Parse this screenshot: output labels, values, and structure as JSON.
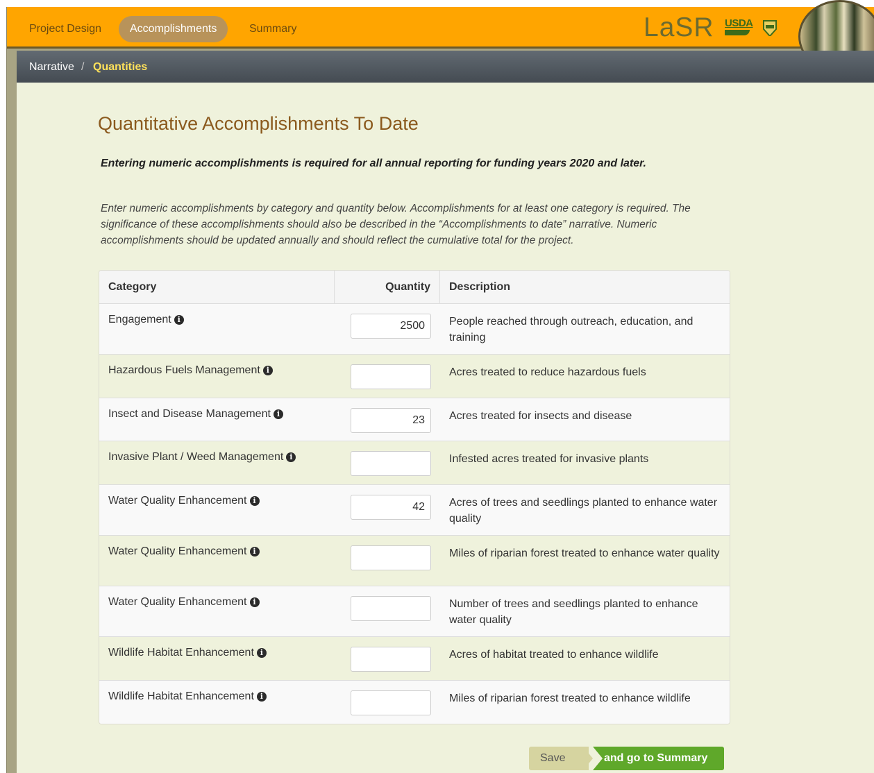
{
  "nav": {
    "tabs": [
      {
        "label": "Project Design",
        "active": false
      },
      {
        "label": "Accomplishments",
        "active": true
      },
      {
        "label": "Summary",
        "active": false
      }
    ]
  },
  "brand": {
    "app_name": "LaSR",
    "usda_label": "USDA",
    "accent_color": "#ffa500"
  },
  "breadcrumb": {
    "items": [
      "Narrative",
      "Quantities"
    ],
    "separator": "/"
  },
  "page": {
    "title": "Quantitative Accomplishments To Date",
    "notice": "Entering numeric accomplishments is required for all annual reporting for funding years 2020 and later.",
    "instructions": "Enter numeric accomplishments by category and quantity below. Accomplishments for at least one category is required. The significance of these accomplishments should also be described in the “Accomplishments to date” narrative. Numeric accomplishments should be updated annually and should reflect the cumulative total for the project."
  },
  "table": {
    "headers": {
      "category": "Category",
      "quantity": "Quantity",
      "description": "Description"
    },
    "info_icon": "info-circle-icon",
    "rows": [
      {
        "category": "Engagement",
        "quantity": "2500",
        "description": "People reached through outreach, education, and training"
      },
      {
        "category": "Hazardous Fuels Management",
        "quantity": "",
        "description": "Acres treated to reduce hazardous fuels"
      },
      {
        "category": "Insect and Disease Management",
        "quantity": "23",
        "description": "Acres treated for insects and disease"
      },
      {
        "category": "Invasive Plant / Weed Management",
        "quantity": "",
        "description": "Infested acres treated for invasive plants"
      },
      {
        "category": "Water Quality Enhancement",
        "quantity": "42",
        "description": "Acres of trees and seedlings planted to enhance water quality"
      },
      {
        "category": "Water Quality Enhancement",
        "quantity": "",
        "description": "Miles of riparian forest treated to enhance water quality"
      },
      {
        "category": "Water Quality Enhancement",
        "quantity": "",
        "description": "Number of trees and seedlings planted to enhance water quality"
      },
      {
        "category": "Wildlife Habitat Enhancement",
        "quantity": "",
        "description": "Acres of habitat treated to enhance wildlife"
      },
      {
        "category": "Wildlife Habitat Enhancement",
        "quantity": "",
        "description": "Miles of riparian forest treated to enhance wildlife"
      }
    ]
  },
  "actions": {
    "save_label": "Save",
    "go_label": "and go to Summary",
    "go_color": "#5fa82a"
  }
}
